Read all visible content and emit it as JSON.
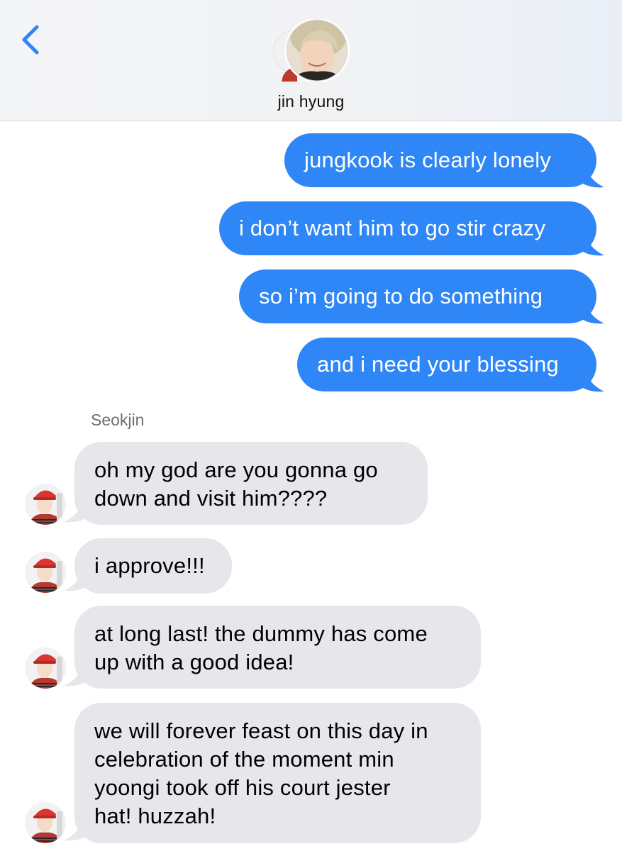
{
  "header": {
    "back_icon": "chevron-left-icon",
    "contact_name": "jin hyung",
    "accent_color": "#2f86f6"
  },
  "conversation": {
    "outgoing_color": "#2f86f6",
    "incoming_color": "#e6e6eb",
    "outgoing": [
      {
        "text": "jungkook is clearly lonely"
      },
      {
        "text": "i don’t want him to go stir crazy"
      },
      {
        "text": "so i’m going to do something"
      },
      {
        "text": "and i need your blessing"
      }
    ],
    "sender_name": "Seokjin",
    "incoming": [
      {
        "lines": [
          "oh my god are you gonna go",
          "down and visit him????"
        ]
      },
      {
        "lines": [
          "i approve!!!"
        ]
      },
      {
        "lines": [
          "at long last! the dummy has come",
          "up with a good idea!"
        ]
      },
      {
        "lines": [
          "we will forever feast on this day in",
          "celebration of the moment min",
          "yoongi took off his court jester",
          "hat! huzzah!"
        ]
      }
    ]
  }
}
